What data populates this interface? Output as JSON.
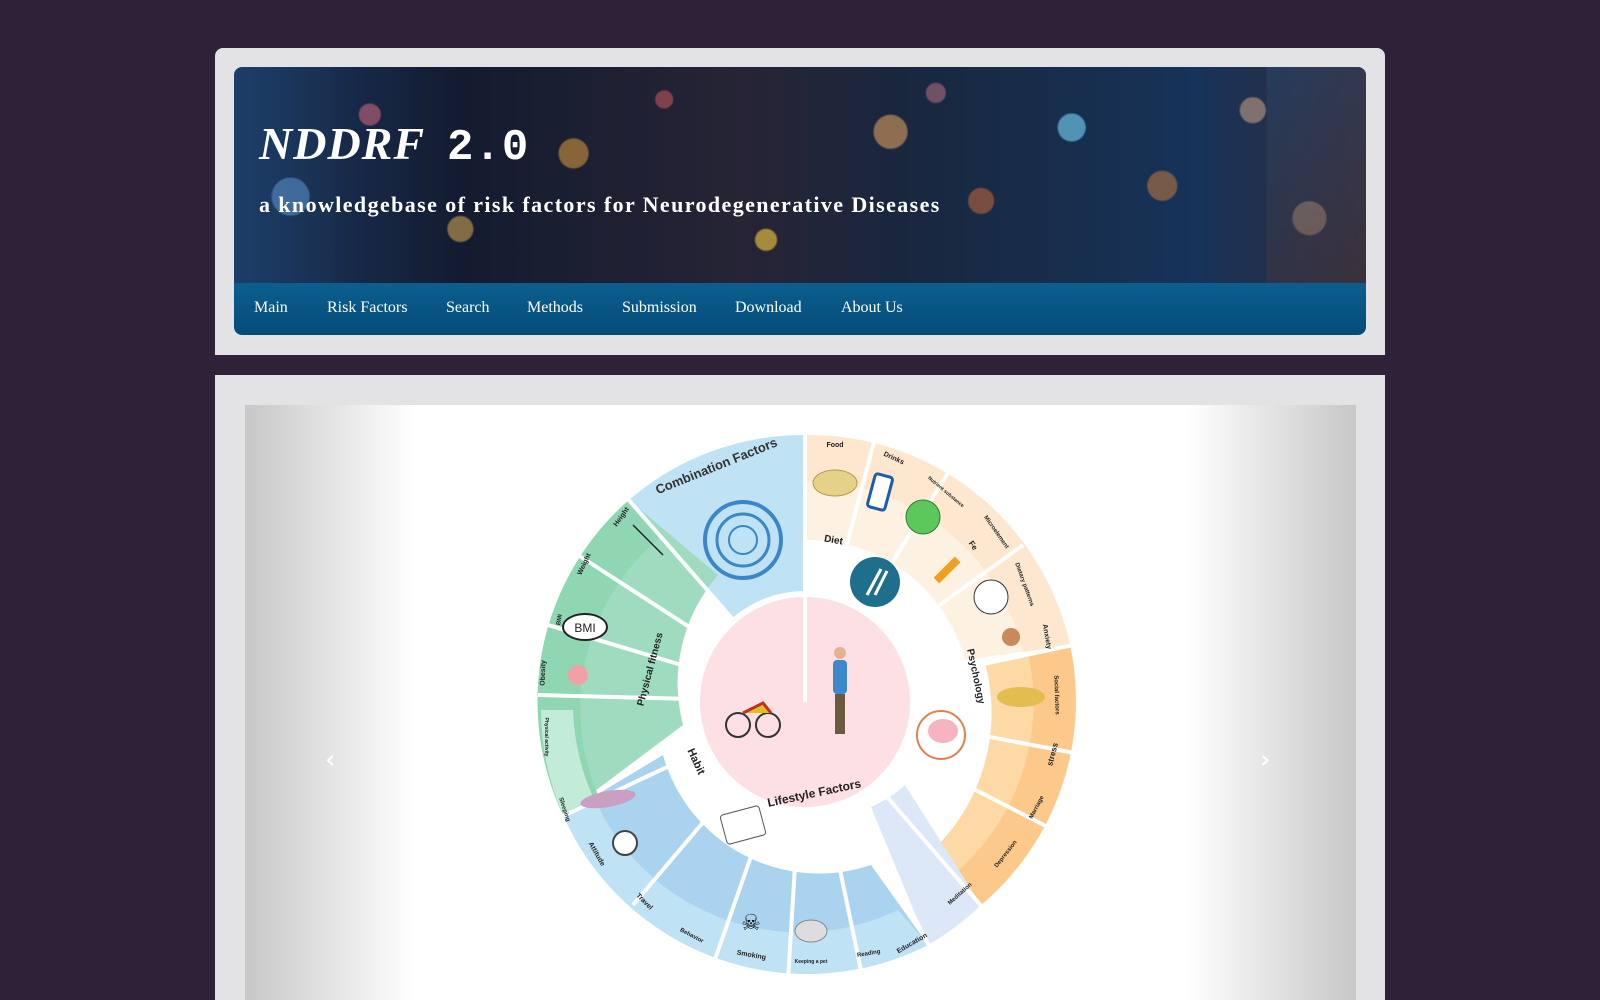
{
  "header": {
    "title": "NDDRF",
    "version": "2.0",
    "subtitle": "a knowledgebase of risk factors for Neurodegenerative Diseases"
  },
  "nav": {
    "items": [
      {
        "label": "Main"
      },
      {
        "label": "Risk Factors"
      },
      {
        "label": "Search"
      },
      {
        "label": "Methods"
      },
      {
        "label": "Submission"
      },
      {
        "label": "Download"
      },
      {
        "label": "About Us"
      }
    ]
  },
  "carousel": {
    "prev_label": "‹",
    "next_label": "›"
  },
  "wheel": {
    "center": "Lifestyle Factors",
    "groups": {
      "combination": "Combination Factors",
      "diet": "Diet",
      "psychology": "Psychology",
      "habit": "Habit",
      "physical_fitness": "Physical fitness",
      "education": "Education"
    },
    "diet_items": {
      "food": "Food",
      "drinks": "Drinks",
      "nutrient": "Nutrient substance",
      "microelement": "Microelement",
      "fe": "Fe",
      "dietary_patterns": "Dietary patterns"
    },
    "psychology_items": {
      "anxiety": "Anxiety",
      "social_factors": "Social factors",
      "stress": "stress",
      "marriage": "Marriage",
      "depression": "Depression",
      "meditation": "Meditation"
    },
    "habit_items": {
      "reading": "Reading",
      "keeping_pet": "Keeping a pet",
      "smoking": "Smoking",
      "behavior": "Behavior",
      "travel": "Travel",
      "attitude": "Attitude",
      "sleeping": "Sleeping"
    },
    "fitness_items": {
      "physical_activity": "Physical activity",
      "obesity": "Obesity",
      "bmi": "BMI",
      "weight": "Weight",
      "height": "Height"
    }
  }
}
